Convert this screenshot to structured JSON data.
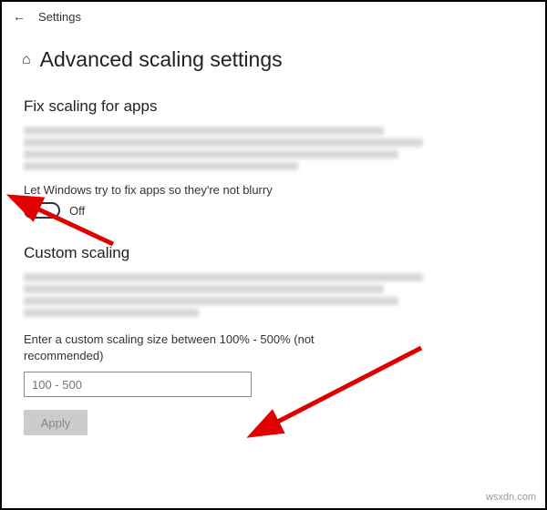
{
  "header": {
    "app_title": "Settings"
  },
  "page": {
    "title": "Advanced scaling settings"
  },
  "section1": {
    "heading": "Fix scaling for apps",
    "toggle_label": "Let Windows try to fix apps so they're not blurry",
    "toggle_state": "Off"
  },
  "section2": {
    "heading": "Custom scaling",
    "input_label": "Enter a custom scaling size between 100% - 500% (not recommended)",
    "input_placeholder": "100 - 500",
    "apply_label": "Apply"
  },
  "watermark": "wsxdn.com"
}
